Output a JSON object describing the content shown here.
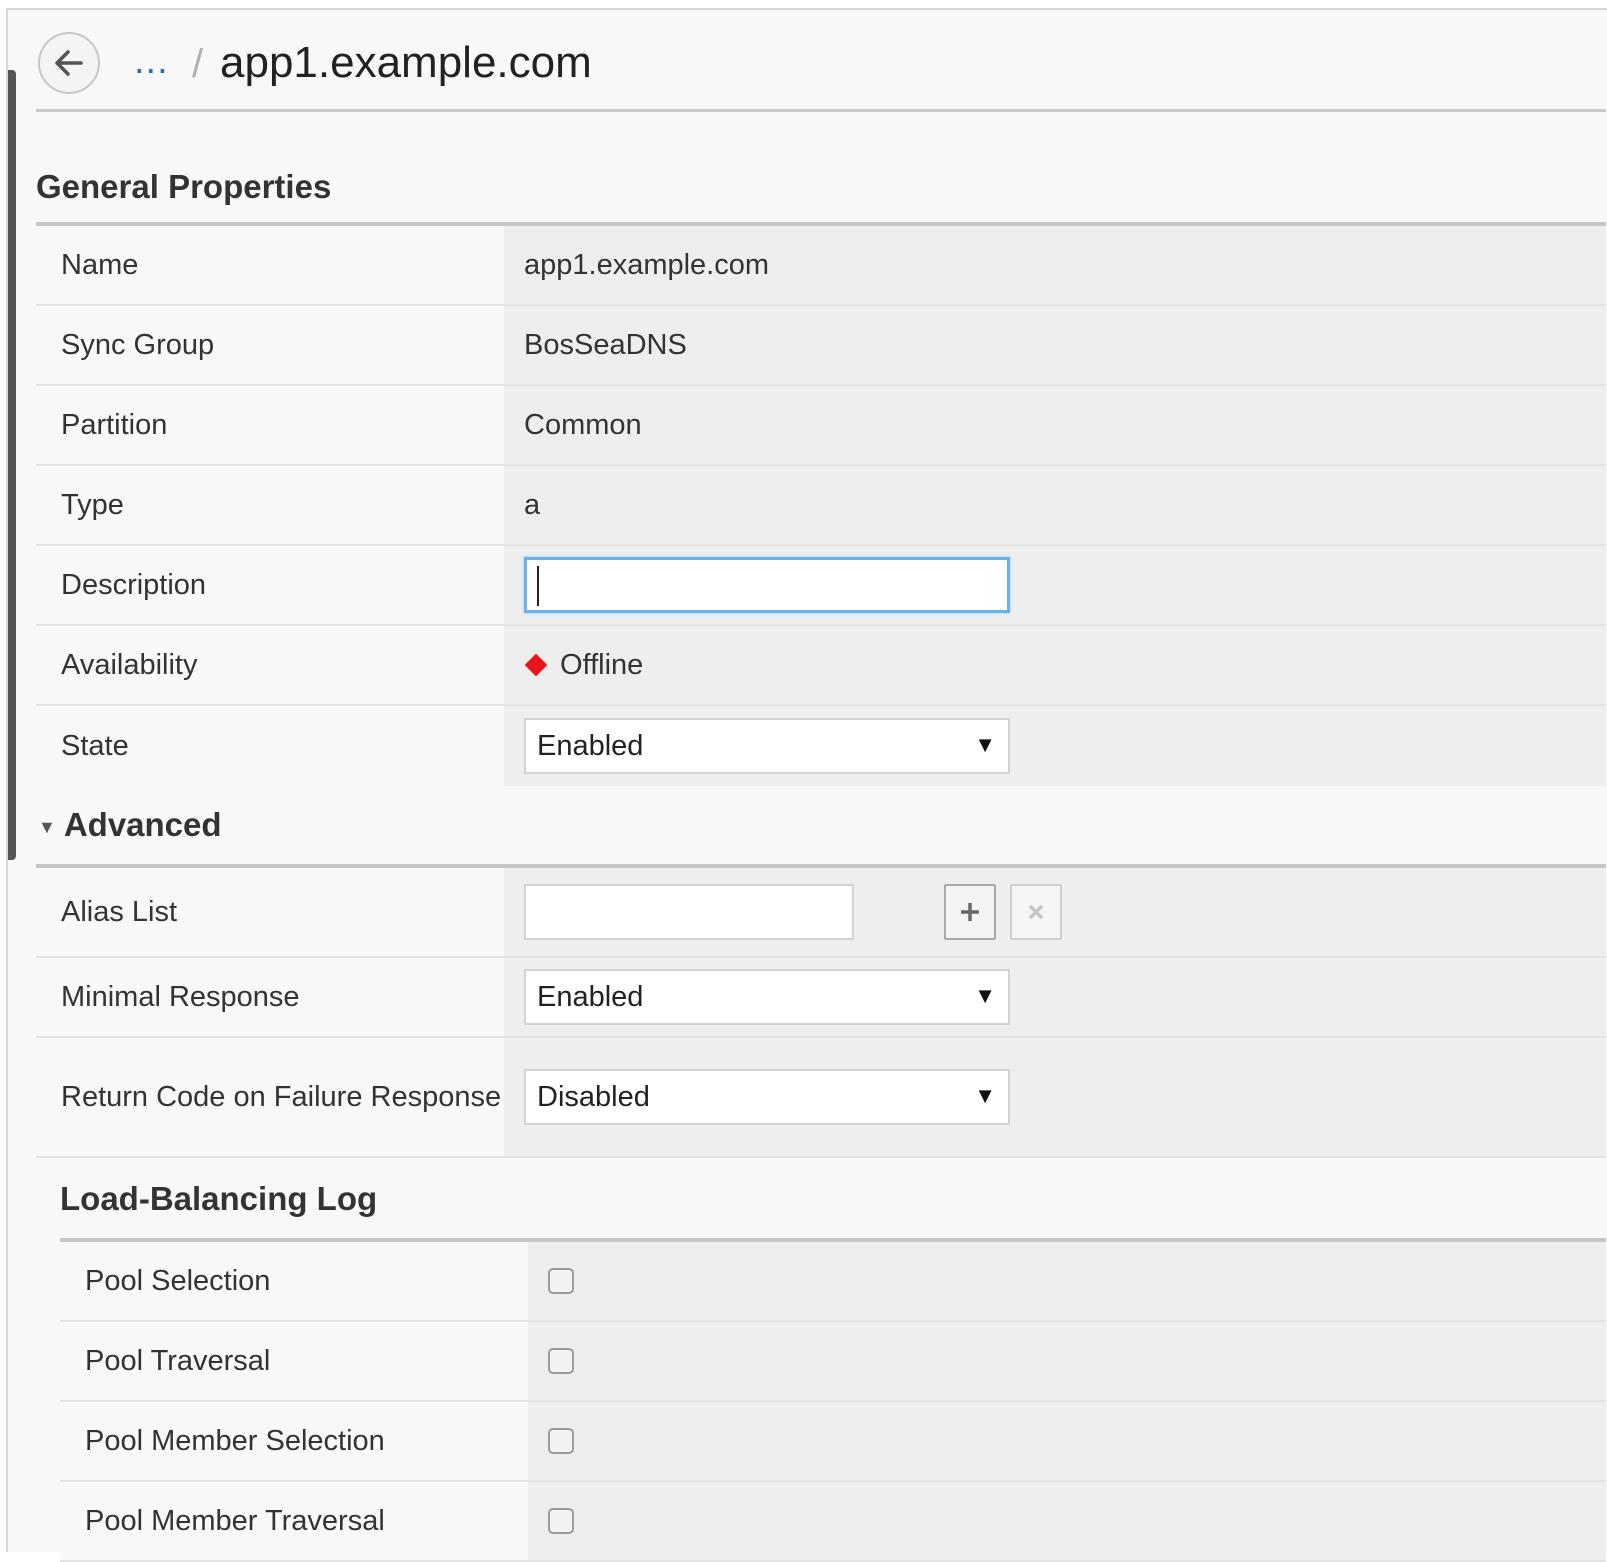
{
  "header": {
    "breadcrumb_ellipsis": "...",
    "separator": "/",
    "title": "app1.example.com"
  },
  "general": {
    "title": "General Properties",
    "name_label": "Name",
    "name_value": "app1.example.com",
    "sync_label": "Sync Group",
    "sync_value": "BosSeaDNS",
    "partition_label": "Partition",
    "partition_value": "Common",
    "type_label": "Type",
    "type_value": "a",
    "description_label": "Description",
    "description_value": "",
    "availability_label": "Availability",
    "availability_value": "Offline",
    "availability_color": "#e8161b",
    "state_label": "State",
    "state_value": "Enabled"
  },
  "advanced": {
    "title": "Advanced",
    "alias_label": "Alias List",
    "alias_value": "",
    "add_icon": "plus-icon",
    "remove_icon": "x-icon",
    "minimal_label": "Minimal Response",
    "minimal_value": "Enabled",
    "rcode_label": "Return Code on Failure Response",
    "rcode_value": "Disabled"
  },
  "lb_log": {
    "title": "Load-Balancing Log",
    "items": [
      {
        "label": "Pool Selection",
        "checked": false
      },
      {
        "label": "Pool Traversal",
        "checked": false
      },
      {
        "label": "Pool Member Selection",
        "checked": false
      },
      {
        "label": "Pool Member Traversal",
        "checked": false
      }
    ]
  },
  "colors": {
    "accent_link": "#2a6ebb",
    "focus_border": "#6ab0ea",
    "value_bg": "#eeeeee",
    "label_bg": "#f8f8f8"
  }
}
